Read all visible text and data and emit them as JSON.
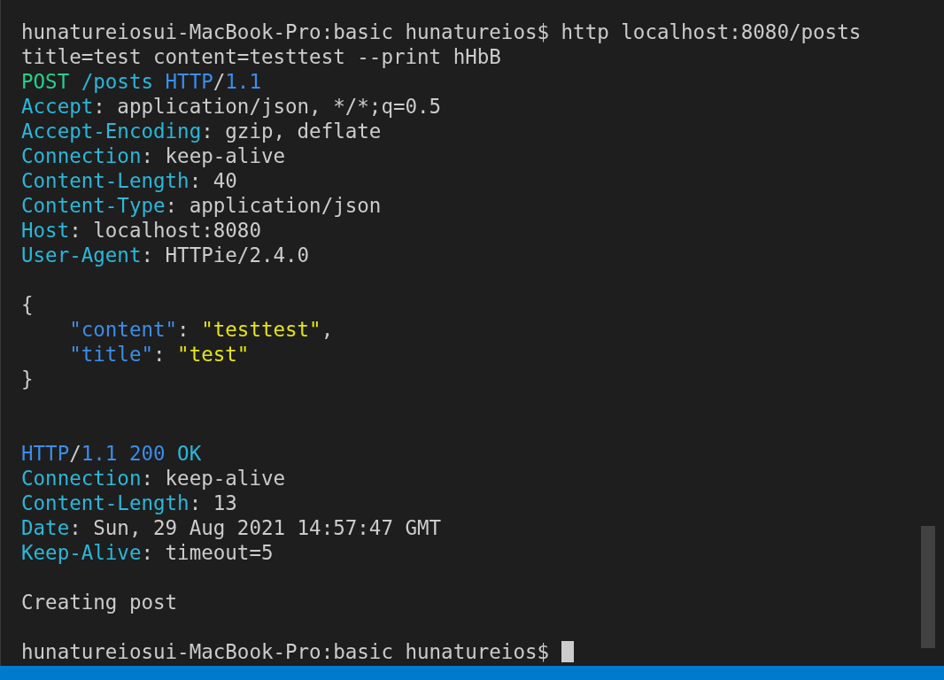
{
  "terminal": {
    "lines": [
      {
        "kind": "text",
        "segments": [
          {
            "kind": "plain",
            "text": "hunatureiosui-MacBook-Pro:basic hunatureios$ http localhost:8080/posts"
          }
        ]
      },
      {
        "kind": "text",
        "segments": [
          {
            "kind": "plain",
            "text": "title=test content=testtest --print hHbB"
          }
        ]
      },
      {
        "kind": "text",
        "segments": [
          {
            "kind": "method",
            "text": "POST "
          },
          {
            "kind": "path",
            "text": "/posts "
          },
          {
            "kind": "proto",
            "text": "HTTP"
          },
          {
            "kind": "plain",
            "text": "/"
          },
          {
            "kind": "proto",
            "text": "1.1"
          }
        ]
      },
      {
        "kind": "text",
        "segments": [
          {
            "kind": "header",
            "text": "Accept"
          },
          {
            "kind": "plain",
            "text": ": application/json, */*;q=0.5"
          }
        ]
      },
      {
        "kind": "text",
        "segments": [
          {
            "kind": "header",
            "text": "Accept-Encoding"
          },
          {
            "kind": "plain",
            "text": ": gzip, deflate"
          }
        ]
      },
      {
        "kind": "text",
        "segments": [
          {
            "kind": "header",
            "text": "Connection"
          },
          {
            "kind": "plain",
            "text": ": keep-alive"
          }
        ]
      },
      {
        "kind": "text",
        "segments": [
          {
            "kind": "header",
            "text": "Content-Length"
          },
          {
            "kind": "plain",
            "text": ": 40"
          }
        ]
      },
      {
        "kind": "text",
        "segments": [
          {
            "kind": "header",
            "text": "Content-Type"
          },
          {
            "kind": "plain",
            "text": ": application/json"
          }
        ]
      },
      {
        "kind": "text",
        "segments": [
          {
            "kind": "header",
            "text": "Host"
          },
          {
            "kind": "plain",
            "text": ": localhost:8080"
          }
        ]
      },
      {
        "kind": "text",
        "segments": [
          {
            "kind": "header",
            "text": "User-Agent"
          },
          {
            "kind": "plain",
            "text": ": HTTPie/2.4.0"
          }
        ]
      },
      {
        "kind": "blank"
      },
      {
        "kind": "text",
        "segments": [
          {
            "kind": "plain",
            "text": "{"
          }
        ]
      },
      {
        "kind": "text",
        "segments": [
          {
            "kind": "key",
            "text": "    \"content\""
          },
          {
            "kind": "plain",
            "text": ": "
          },
          {
            "kind": "string",
            "text": "\"testtest\""
          },
          {
            "kind": "plain",
            "text": ","
          }
        ]
      },
      {
        "kind": "text",
        "segments": [
          {
            "kind": "key",
            "text": "    \"title\""
          },
          {
            "kind": "plain",
            "text": ": "
          },
          {
            "kind": "string",
            "text": "\"test\""
          }
        ]
      },
      {
        "kind": "text",
        "segments": [
          {
            "kind": "plain",
            "text": "}"
          }
        ]
      },
      {
        "kind": "blank"
      },
      {
        "kind": "blank"
      },
      {
        "kind": "text",
        "segments": [
          {
            "kind": "proto",
            "text": "HTTP"
          },
          {
            "kind": "plain",
            "text": "/"
          },
          {
            "kind": "proto",
            "text": "1.1 200 "
          },
          {
            "kind": "path",
            "text": "OK"
          }
        ]
      },
      {
        "kind": "text",
        "segments": [
          {
            "kind": "header",
            "text": "Connection"
          },
          {
            "kind": "plain",
            "text": ": keep-alive"
          }
        ]
      },
      {
        "kind": "text",
        "segments": [
          {
            "kind": "header",
            "text": "Content-Length"
          },
          {
            "kind": "plain",
            "text": ": 13"
          }
        ]
      },
      {
        "kind": "text",
        "segments": [
          {
            "kind": "header",
            "text": "Date"
          },
          {
            "kind": "plain",
            "text": ": Sun, 29 Aug 2021 14:57:47 GMT"
          }
        ]
      },
      {
        "kind": "text",
        "segments": [
          {
            "kind": "header",
            "text": "Keep-Alive"
          },
          {
            "kind": "plain",
            "text": ": timeout=5"
          }
        ]
      },
      {
        "kind": "blank"
      },
      {
        "kind": "text",
        "segments": [
          {
            "kind": "plain",
            "text": "Creating post"
          }
        ]
      },
      {
        "kind": "blank"
      },
      {
        "kind": "text",
        "segments": [
          {
            "kind": "plain",
            "text": "hunatureiosui-MacBook-Pro:basic hunatureios$ "
          }
        ]
      }
    ],
    "cursor": {
      "shown": true
    }
  }
}
